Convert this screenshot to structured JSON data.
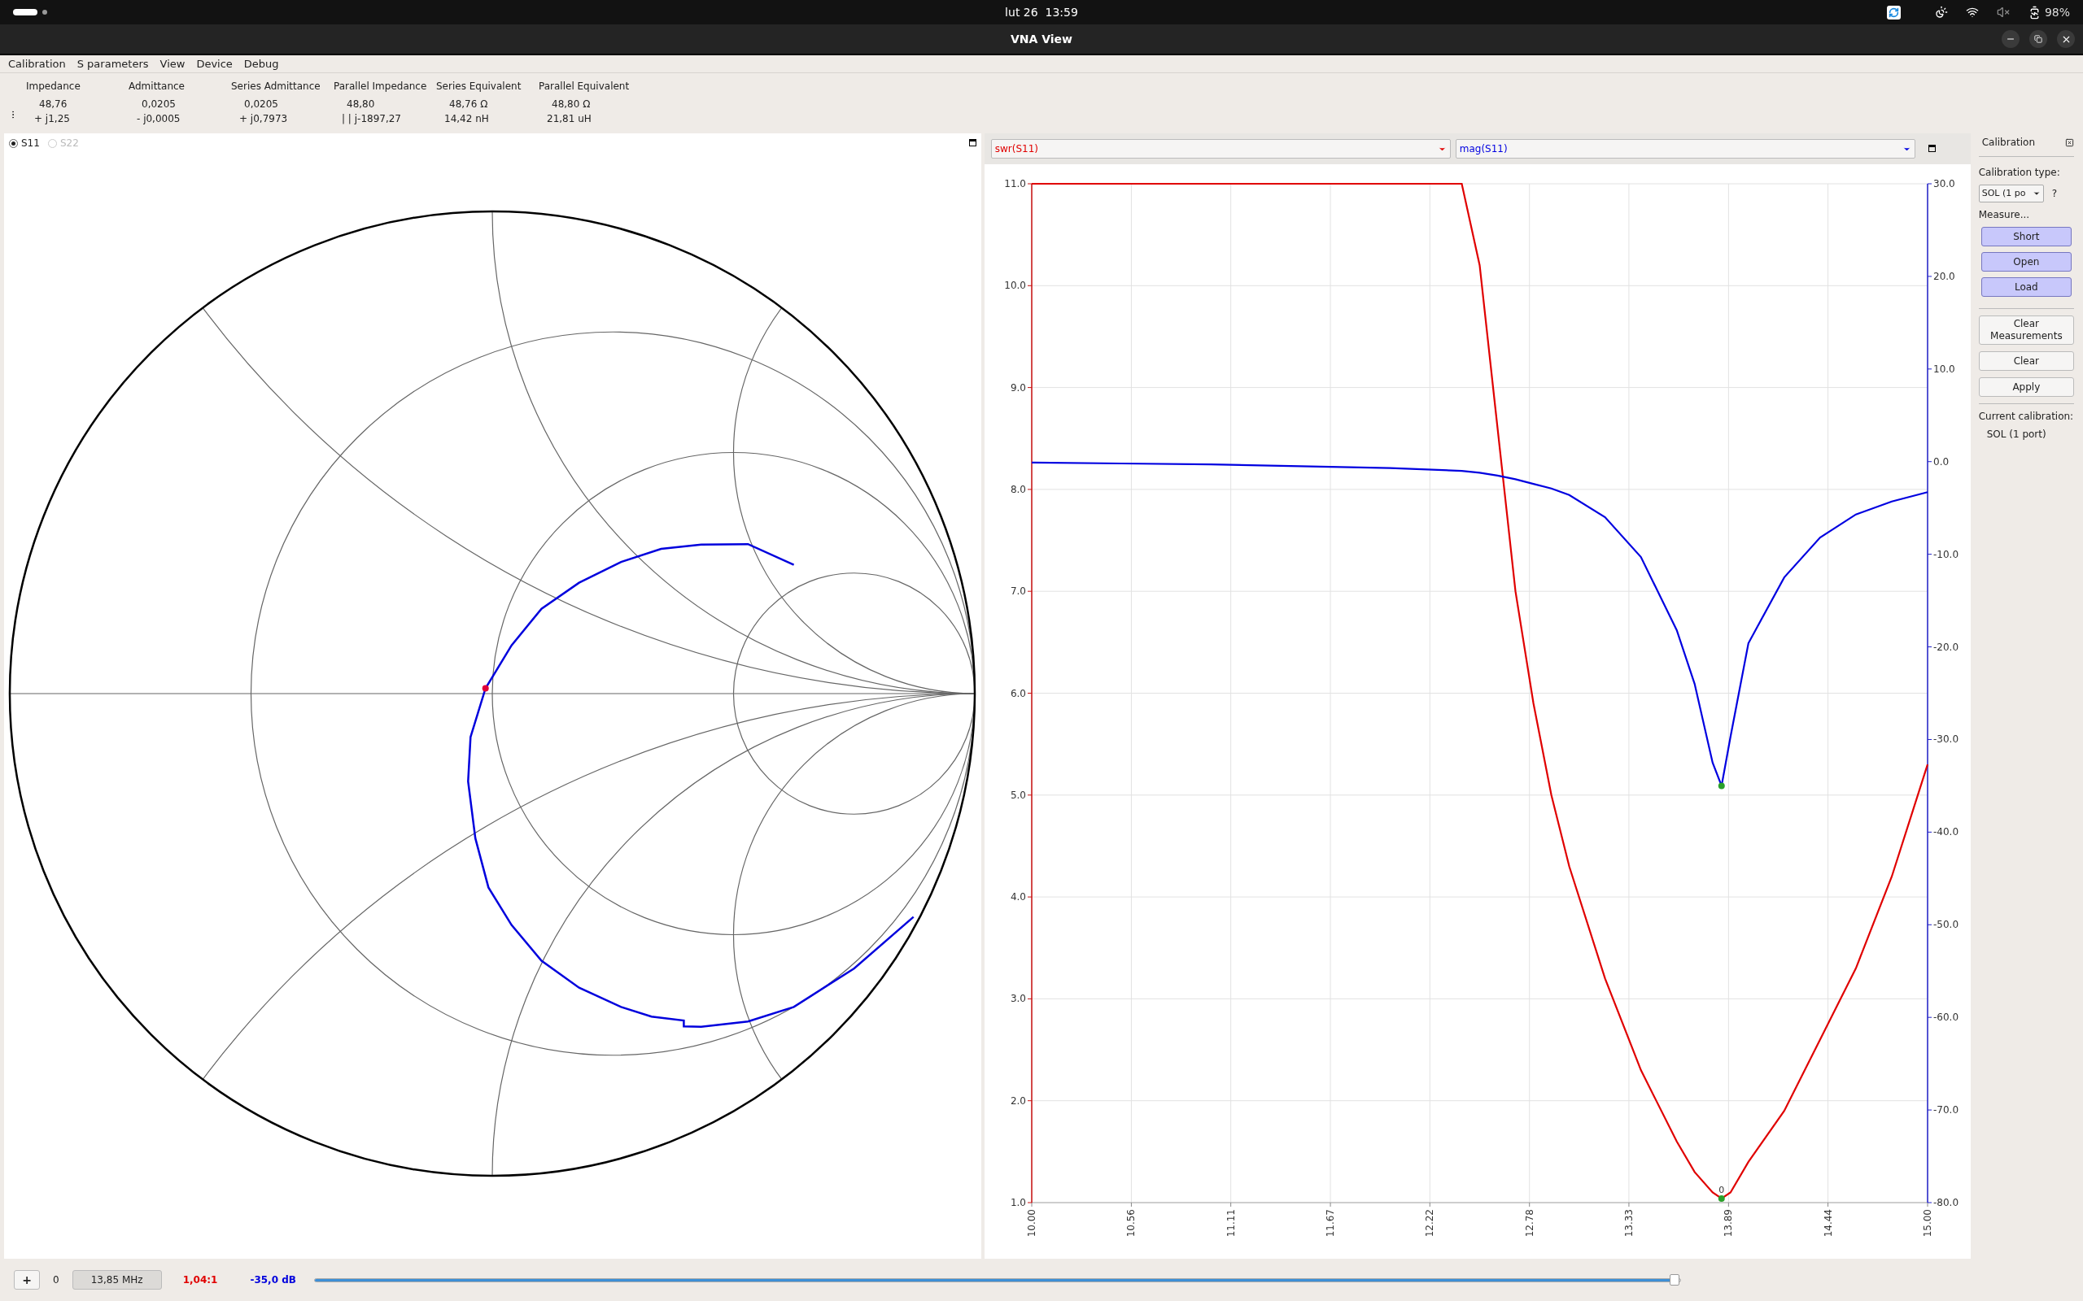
{
  "system_bar": {
    "clock": "lut 26  13:59",
    "battery": "98%"
  },
  "window": {
    "title": "VNA View"
  },
  "menu": [
    "Calibration",
    "S parameters",
    "View",
    "Device",
    "Debug"
  ],
  "readouts": [
    {
      "label": "Impedance",
      "line_1": "48,76",
      "line_2": "+ j1,25"
    },
    {
      "label": "Admittance",
      "line_1": "0,0205",
      "line_2": "- j0,0005"
    },
    {
      "label": "Series Admittance",
      "line_1": "0,0205",
      "line_2": "+ j0,7973"
    },
    {
      "label": "Parallel Impedance",
      "line_1": "48,80",
      "line_2": "| | j-1897,27"
    },
    {
      "label": "Series Equivalent",
      "line_1": "48,76 Ω",
      "line_2": "14,42 nH"
    },
    {
      "label": "Parallel Equivalent",
      "line_1": "48,80 Ω",
      "line_2": "21,81 uH"
    }
  ],
  "smith": {
    "ports": [
      {
        "label": "S11",
        "selected": true,
        "disabled": false
      },
      {
        "label": "S22",
        "selected": false,
        "disabled": true
      }
    ]
  },
  "plot": {
    "chart_data": {
      "type": "line",
      "x": [
        10,
        10.5,
        11,
        11.5,
        12,
        12.4,
        12.5,
        12.6,
        12.7,
        12.8,
        12.9,
        13.0,
        13.2,
        13.4,
        13.6,
        13.7,
        13.8,
        13.85,
        13.9,
        14.0,
        14.2,
        14.4,
        14.6,
        14.8,
        15.0
      ],
      "series": [
        {
          "name": "swr(S11)",
          "color": "#e00000",
          "values": [
            11,
            11,
            11,
            11,
            11,
            11,
            10.2,
            8.6,
            7.0,
            5.9,
            5.0,
            4.3,
            3.2,
            2.3,
            1.6,
            1.3,
            1.1,
            1.04,
            1.1,
            1.4,
            1.9,
            2.6,
            3.3,
            4.2,
            5.3
          ]
        },
        {
          "name": "mag(S11)",
          "color": "#0000e0",
          "axis": "y2",
          "values": [
            -0.1,
            -0.2,
            -0.3,
            -0.5,
            -0.7,
            -1.0,
            -1.2,
            -1.5,
            -1.9,
            -2.4,
            -2.9,
            -3.6,
            -6.0,
            -10.3,
            -18.2,
            -24.0,
            -32.5,
            -35.0,
            -29.7,
            -19.6,
            -12.5,
            -8.2,
            -5.7,
            -4.3,
            -3.3
          ]
        }
      ],
      "xlim": [
        10,
        15
      ],
      "ylim": [
        1,
        11
      ],
      "y2lim": [
        -80,
        30
      ],
      "xticks": [
        {
          "value": 10,
          "label": "10.00"
        },
        {
          "value": 10.556,
          "label": "10.56"
        },
        {
          "value": 11.111,
          "label": "11.11"
        },
        {
          "value": 11.667,
          "label": "11.67"
        },
        {
          "value": 12.222,
          "label": "12.22"
        },
        {
          "value": 12.778,
          "label": "12.78"
        },
        {
          "value": 13.333,
          "label": "13.33"
        },
        {
          "value": 13.889,
          "label": "13.89"
        },
        {
          "value": 14.444,
          "label": "14.44"
        },
        {
          "value": 15,
          "label": "15.00"
        }
      ],
      "yticks": [
        {
          "value": 1,
          "label": "1.0"
        },
        {
          "value": 2,
          "label": "2.0"
        },
        {
          "value": 3,
          "label": "3.0"
        },
        {
          "value": 4,
          "label": "4.0"
        },
        {
          "value": 5,
          "label": "5.0"
        },
        {
          "value": 6,
          "label": "6.0"
        },
        {
          "value": 7,
          "label": "7.0"
        },
        {
          "value": 8,
          "label": "8.0"
        },
        {
          "value": 9,
          "label": "9.0"
        },
        {
          "value": 10,
          "label": "10.0"
        },
        {
          "value": 11,
          "label": "11.0"
        }
      ],
      "y2ticks": [
        {
          "value": 30,
          "label": "30.0"
        },
        {
          "value": 20,
          "label": "20.0"
        },
        {
          "value": 10,
          "label": "10.0"
        },
        {
          "value": 0,
          "label": "0.0"
        },
        {
          "value": -10,
          "label": "-10.0"
        },
        {
          "value": -20,
          "label": "-20.0"
        },
        {
          "value": -30,
          "label": "-30.0"
        },
        {
          "value": -40,
          "label": "-40.0"
        },
        {
          "value": -50,
          "label": "-50.0"
        },
        {
          "value": -60,
          "label": "-60.0"
        },
        {
          "value": -70,
          "label": "-70.0"
        },
        {
          "value": -80,
          "label": "-80.0"
        }
      ],
      "grid": true,
      "annotations": [
        {
          "x": 13.85,
          "y": 1.04,
          "text": "0"
        }
      ]
    }
  },
  "calibration": {
    "title": "Calibration",
    "type_label": "Calibration type:",
    "type_value": "SOL (1 po",
    "help": "?",
    "measure_label": "Measure...",
    "measure_buttons": [
      "Short",
      "Open",
      "Load"
    ],
    "actions": [
      "Clear Measurements",
      "Clear",
      "Apply"
    ],
    "current_label": "Current calibration:",
    "current_value": "SOL (1 port)"
  },
  "marker_bar": {
    "add": "+",
    "index": "0",
    "frequency": "13,85 MHz",
    "swr": "1,04:1",
    "magnitude": "-35,0 dB",
    "level": 0.995
  }
}
